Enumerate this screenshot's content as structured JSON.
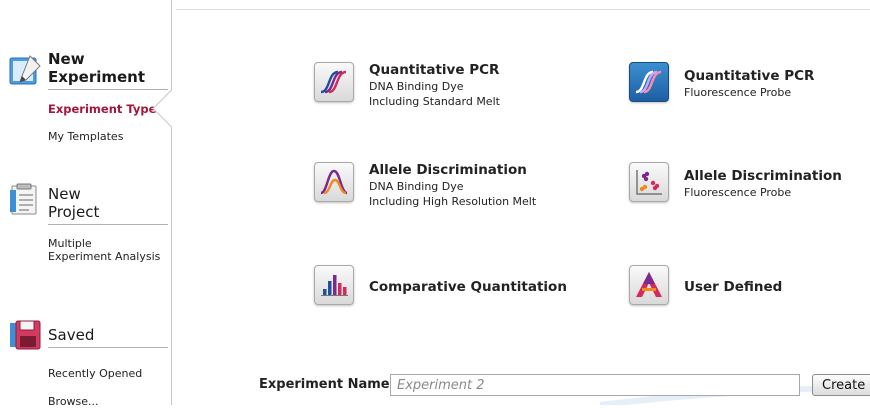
{
  "sidebar": {
    "new_experiment": {
      "title_line1": "New",
      "title_line2": "Experiment",
      "items": [
        {
          "label": "Experiment Types",
          "active": true
        },
        {
          "label": "My Templates",
          "active": false
        }
      ]
    },
    "new_project": {
      "title_line1": "New",
      "title_line2": "Project",
      "items": [
        {
          "label_line1": "Multiple",
          "label_line2": "Experiment Analysis"
        }
      ]
    },
    "saved": {
      "title": "Saved",
      "items": [
        {
          "label": "Recently Opened"
        },
        {
          "label": "Browse..."
        }
      ]
    }
  },
  "experiment_types": [
    {
      "title": "Quantitative PCR",
      "lines": [
        "DNA Binding Dye",
        "Including Standard Melt"
      ],
      "icon": "qpcr-curves-icon"
    },
    {
      "title": "Quantitative PCR",
      "lines": [
        "Fluorescence Probe"
      ],
      "icon": "qpcr-curves-icon",
      "selected": true
    },
    {
      "title": "Allele Discrimination",
      "lines": [
        "DNA Binding Dye",
        "Including High Resolution Melt"
      ],
      "icon": "melt-curve-icon"
    },
    {
      "title": "Allele Discrimination",
      "lines": [
        "Fluorescence Probe"
      ],
      "icon": "scatter-plot-icon"
    },
    {
      "title": "Comparative Quantitation",
      "lines": [],
      "icon": "bar-chart-icon"
    },
    {
      "title": "User Defined",
      "lines": [],
      "icon": "user-defined-icon"
    }
  ],
  "experiment_name": {
    "label": "Experiment Name",
    "placeholder": "Experiment 2",
    "value": ""
  },
  "create_button_label": "Create",
  "colors": {
    "active_item": "#a3173a",
    "selected_tile": "#2a74ba",
    "divider": "#c8c8c8"
  }
}
